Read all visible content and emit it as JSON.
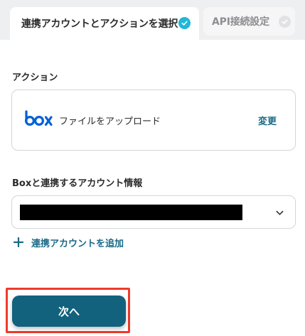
{
  "tabs": [
    {
      "label": "連携アカウントとアクションを選択",
      "state": "active",
      "completed": true
    },
    {
      "label": "API接続設定",
      "state": "inactive",
      "completed": false
    }
  ],
  "action_section": {
    "label": "アクション",
    "service_icon": "box-logo",
    "action_name": "ファイルをアップロード",
    "change_label": "変更"
  },
  "account_section": {
    "label": "Boxと連携するアカウント情報",
    "selected_value_redacted": true,
    "add_account_label": "連携アカウントを追加"
  },
  "next_button_label": "次へ",
  "colors": {
    "accent": "#12627d",
    "link": "#1a6a86",
    "check": "#1fb8d7",
    "highlight": "#ee3a2a",
    "box_brand": "#0061d5"
  }
}
